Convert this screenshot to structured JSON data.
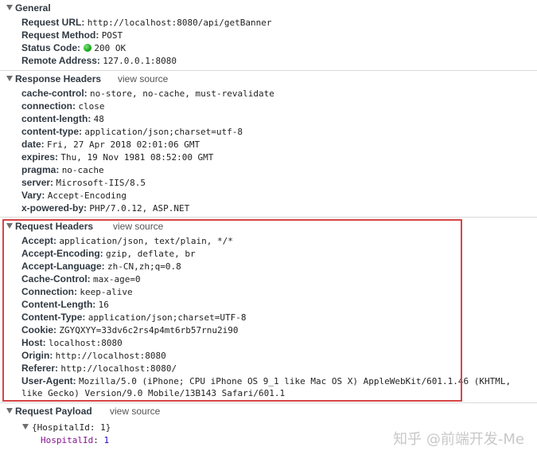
{
  "general": {
    "title": "General",
    "rows": [
      {
        "key": "Request URL:",
        "value": "http://localhost:8080/api/getBanner"
      },
      {
        "key": "Request Method:",
        "value": "POST"
      },
      {
        "key": "Status Code:",
        "value": "200 OK"
      },
      {
        "key": "Remote Address:",
        "value": "127.0.0.1:8080"
      }
    ],
    "status_color": "#18a918"
  },
  "response_headers": {
    "title": "Response Headers",
    "view_source": "view source",
    "rows": [
      {
        "key": "cache-control:",
        "value": "no-store, no-cache, must-revalidate"
      },
      {
        "key": "connection:",
        "value": "close"
      },
      {
        "key": "content-length:",
        "value": "48"
      },
      {
        "key": "content-type:",
        "value": "application/json;charset=utf-8"
      },
      {
        "key": "date:",
        "value": "Fri, 27 Apr 2018 02:01:06 GMT"
      },
      {
        "key": "expires:",
        "value": "Thu, 19 Nov 1981 08:52:00 GMT"
      },
      {
        "key": "pragma:",
        "value": "no-cache"
      },
      {
        "key": "server:",
        "value": "Microsoft-IIS/8.5"
      },
      {
        "key": "Vary:",
        "value": "Accept-Encoding"
      },
      {
        "key": "x-powered-by:",
        "value": "PHP/7.0.12, ASP.NET"
      }
    ]
  },
  "request_headers": {
    "title": "Request Headers",
    "view_source": "view source",
    "highlight_color": "#d64545",
    "rows": [
      {
        "key": "Accept:",
        "value": "application/json, text/plain, */*"
      },
      {
        "key": "Accept-Encoding:",
        "value": "gzip, deflate, br"
      },
      {
        "key": "Accept-Language:",
        "value": "zh-CN,zh;q=0.8"
      },
      {
        "key": "Cache-Control:",
        "value": "max-age=0"
      },
      {
        "key": "Connection:",
        "value": "keep-alive"
      },
      {
        "key": "Content-Length:",
        "value": "16"
      },
      {
        "key": "Content-Type:",
        "value": "application/json;charset=UTF-8"
      },
      {
        "key": "Cookie:",
        "value": "ZGYQXYY=33dv6c2rs4p4mt6rb57rnu2i90"
      },
      {
        "key": "Host:",
        "value": "localhost:8080"
      },
      {
        "key": "Origin:",
        "value": "http://localhost:8080"
      },
      {
        "key": "Referer:",
        "value": "http://localhost:8080/"
      },
      {
        "key": "User-Agent:",
        "value": "Mozilla/5.0 (iPhone; CPU iPhone OS 9_1 like Mac OS X) AppleWebKit/601.1.46 (KHTML,"
      }
    ],
    "user_agent_continuation": "like Gecko) Version/9.0 Mobile/13B143 Safari/601.1"
  },
  "request_payload": {
    "title": "Request Payload",
    "view_source": "view source",
    "object_summary": "{HospitalId: 1}",
    "property_key": "HospitalId",
    "property_value": "1"
  },
  "watermark": "知乎 @前端开发-Me"
}
